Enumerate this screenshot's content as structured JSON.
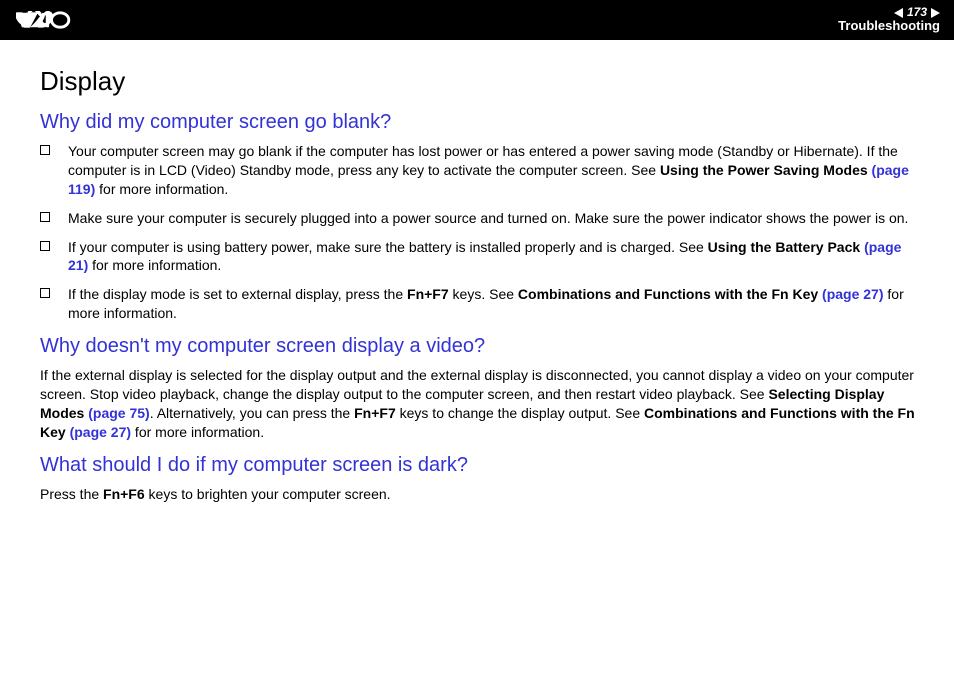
{
  "header": {
    "page_number": "173",
    "section": "Troubleshooting"
  },
  "title": "Display",
  "q1": {
    "heading": "Why did my computer screen go blank?",
    "items": [
      {
        "pre": "Your computer screen may go blank if the computer has lost power or has entered a power saving mode (Standby or Hibernate). If the computer is in LCD (Video) Standby mode, press any key to activate the computer screen. See ",
        "bold1": "Using the Power Saving Modes ",
        "link": "(page 119)",
        "post": " for more information."
      },
      {
        "pre": "Make sure your computer is securely plugged into a power source and turned on. Make sure the power indicator shows the power is on.",
        "bold1": "",
        "link": "",
        "post": ""
      },
      {
        "pre": "If your computer is using battery power, make sure the battery is installed properly and is charged. See ",
        "bold1": "Using the Battery Pack ",
        "link": "(page 21)",
        "post": " for more information."
      },
      {
        "pre": "If the display mode is set to external display, press the ",
        "bold1": "Fn+F7",
        "mid": " keys. See ",
        "bold2": "Combinations and Functions with the Fn Key ",
        "link": "(page 27)",
        "post": " for more information."
      }
    ]
  },
  "q2": {
    "heading": "Why doesn't my computer screen display a video?",
    "p_pre": "If the external display is selected for the display output and the external display is disconnected, you cannot display a video on your computer screen. Stop video playback, change the display output to the computer screen, and then restart video playback. See ",
    "p_b1": "Selecting Display Modes ",
    "p_l1": "(page 75)",
    "p_mid": ". Alternatively, you can press the ",
    "p_b2": "Fn+F7",
    "p_mid2": " keys to change the display output. See ",
    "p_b3": "Combinations and Functions with the Fn Key ",
    "p_l2": "(page 27)",
    "p_post": " for more information."
  },
  "q3": {
    "heading": "What should I do if my computer screen is dark?",
    "p_pre": "Press the ",
    "p_b1": "Fn+F6",
    "p_post": " keys to brighten your computer screen."
  }
}
